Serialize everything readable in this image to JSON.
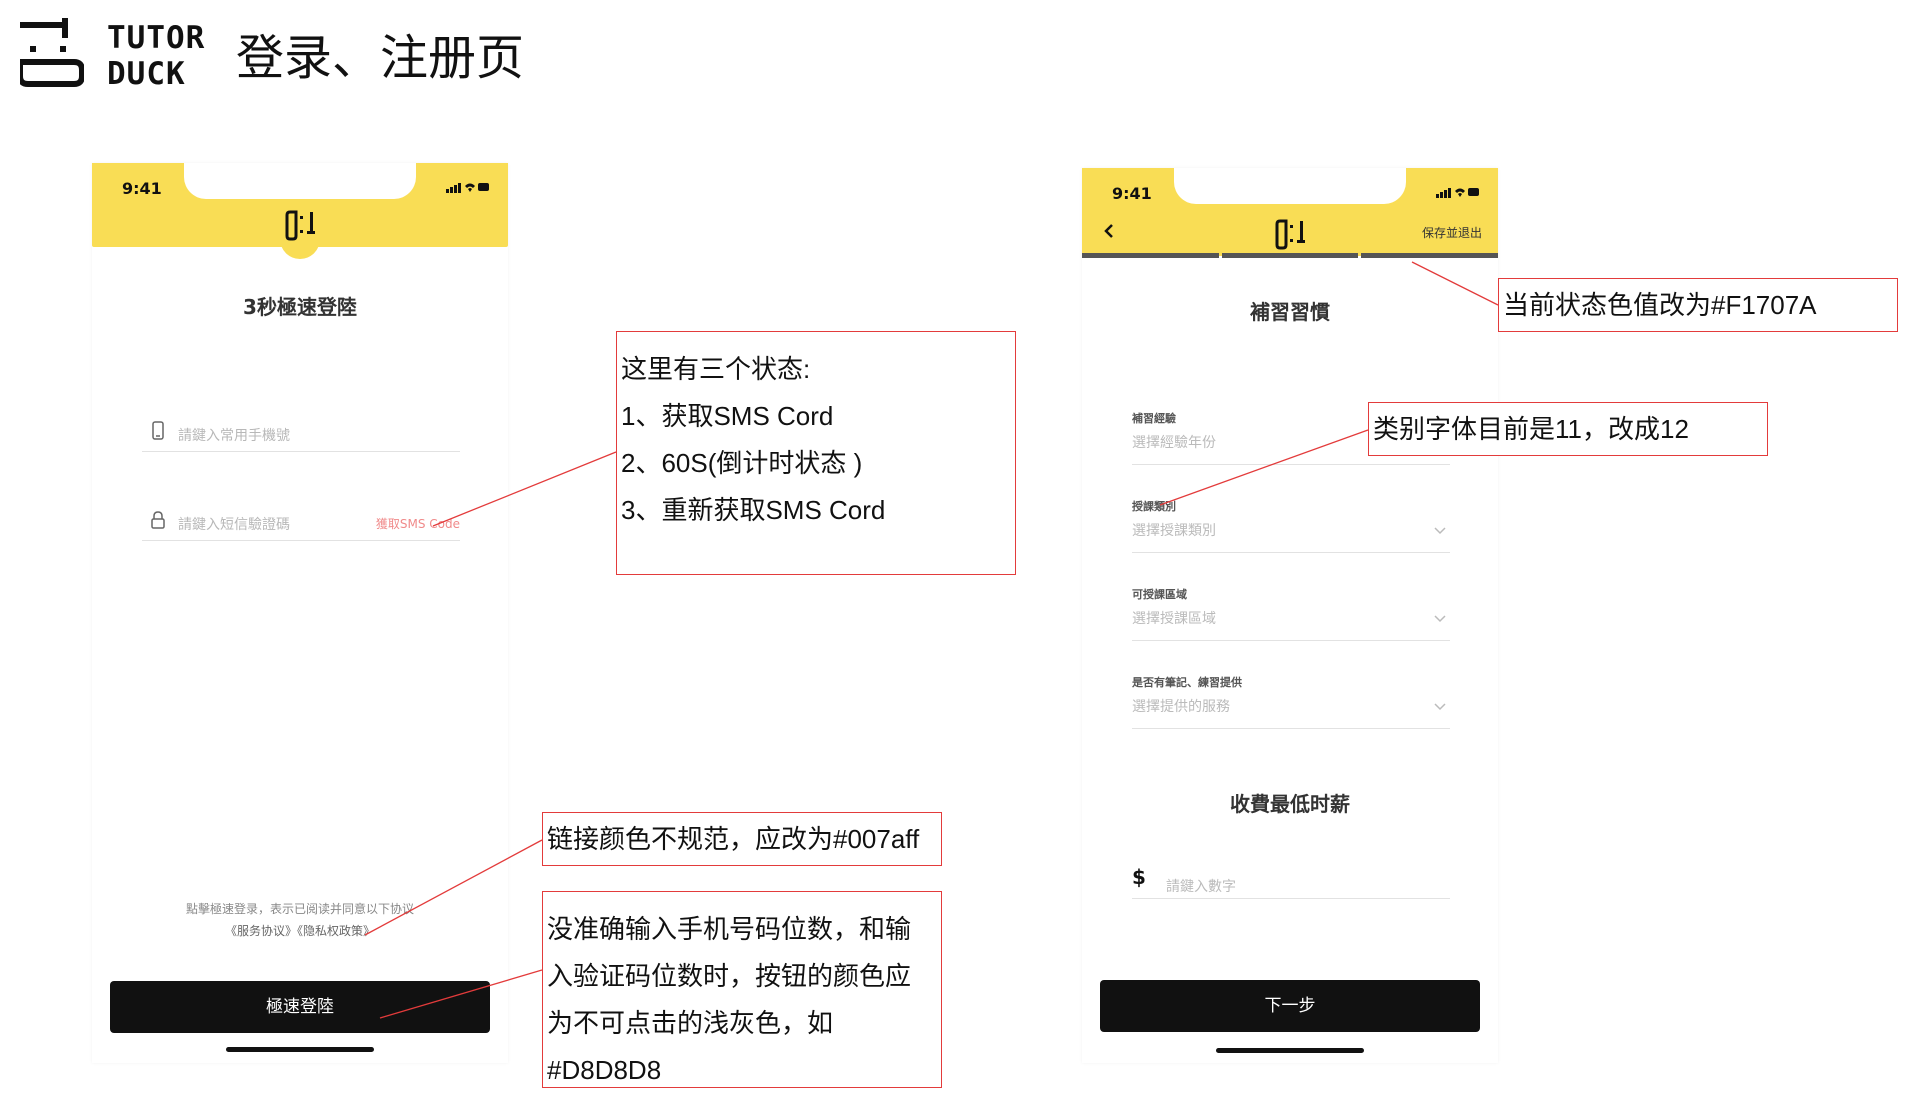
{
  "header": {
    "brand_line1": "TUTOR",
    "brand_line2": "DUCK",
    "page_title": "登录、注册页"
  },
  "login_screen": {
    "status_time": "9:41",
    "title": "3秒極速登陸",
    "phone_placeholder": "請鍵入常用手機號",
    "code_placeholder": "請鍵入短信驗證碼",
    "sms_link": "獲取SMS Code",
    "agreement_text": "點擊極速登录，表示已阅读并同意以下协议",
    "agreement_links": "《服务协议》《隐私权政策》",
    "login_button": "極速登陸"
  },
  "profile_screen": {
    "status_time": "9:41",
    "save_exit": "保存並退出",
    "title": "補習習慣",
    "fields": [
      {
        "label": "補習經驗",
        "placeholder": "選擇經驗年份"
      },
      {
        "label": "授課類別",
        "placeholder": "選擇授課類別"
      },
      {
        "label": "可授課區域",
        "placeholder": "選擇授課區域"
      },
      {
        "label": "是否有筆記、練習提供",
        "placeholder": "選擇提供的服務"
      }
    ],
    "wage_title": "收費最低时薪",
    "currency": "$",
    "wage_placeholder": "請鍵入數字",
    "next_button": "下一步"
  },
  "annotations": {
    "states": {
      "line1": "这里有三个状态:",
      "line2": "1、获取SMS Cord",
      "line3": "2、60S(倒计时状态 )",
      "line4": "3、重新获取SMS Cord"
    },
    "link_color": "链接颜色不规范，应改为#007aff",
    "button_state": {
      "line1": "没准确输入手机号码位数，和输",
      "line2": "入验证码位数时，按钮的颜色应",
      "line3": "为不可点击的浅灰色，如",
      "line4": "#D8D8D8"
    },
    "progress_color": "当前状态色值改为#F1707A",
    "font_size": "类别字体目前是11，改成12"
  },
  "colors": {
    "brand_yellow": "#f9dd55",
    "annotation_red": "#e33b3b",
    "button_black": "#111111"
  }
}
